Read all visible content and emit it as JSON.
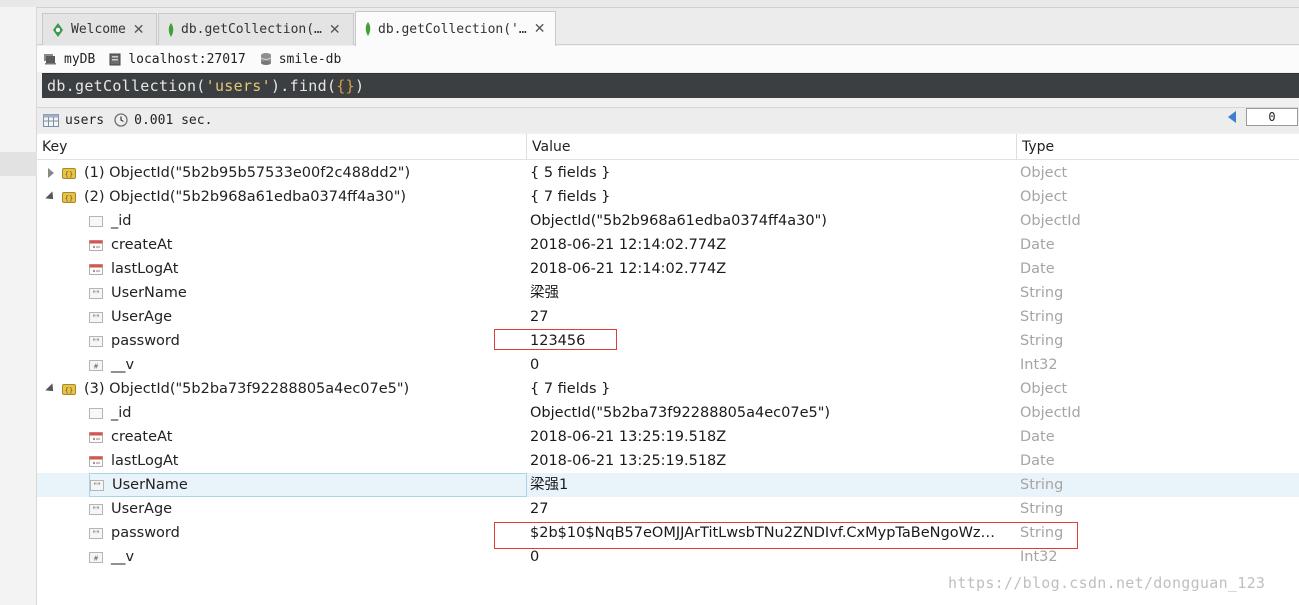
{
  "tabs": [
    {
      "label": "Welcome",
      "active": false
    },
    {
      "label": "db.getCollection(…",
      "active": false
    },
    {
      "label": "db.getCollection('…",
      "active": true
    }
  ],
  "path": {
    "database_label": "myDB",
    "host": "localhost:27017",
    "db_name": "smile-db"
  },
  "query": {
    "prefix": "db.getCollection(",
    "collection": "'users'",
    "middle": ").find(",
    "arg": "{}",
    "suffix": ")"
  },
  "result": {
    "collection": "users",
    "time": "0.001 sec.",
    "page_value": "0"
  },
  "columns": {
    "key": "Key",
    "value": "Value",
    "type": "Type"
  },
  "rows": [
    {
      "key": "(1) ObjectId(\"5b2b95b57533e00f2c488dd2\")",
      "value": "{ 5 fields }",
      "type": "Object",
      "icon": "object-icon"
    },
    {
      "key": "(2) ObjectId(\"5b2b968a61edba0374ff4a30\")",
      "value": "{ 7 fields }",
      "type": "Object",
      "icon": "object-icon"
    },
    {
      "key": "_id",
      "value": "ObjectId(\"5b2b968a61edba0374ff4a30\")",
      "type": "ObjectId",
      "icon": "objectid-icon"
    },
    {
      "key": "createAt",
      "value": "2018-06-21 12:14:02.774Z",
      "type": "Date",
      "icon": "date-icon"
    },
    {
      "key": "lastLogAt",
      "value": "2018-06-21 12:14:02.774Z",
      "type": "Date",
      "icon": "date-icon"
    },
    {
      "key": "UserName",
      "value": "梁强",
      "type": "String",
      "icon": "string-icon"
    },
    {
      "key": "UserAge",
      "value": "27",
      "type": "String",
      "icon": "string-icon"
    },
    {
      "key": "password",
      "value": "123456",
      "type": "String",
      "icon": "string-icon"
    },
    {
      "key": "__v",
      "value": "0",
      "type": "Int32",
      "icon": "int32-icon"
    },
    {
      "key": "(3) ObjectId(\"5b2ba73f92288805a4ec07e5\")",
      "value": "{ 7 fields }",
      "type": "Object",
      "icon": "object-icon"
    },
    {
      "key": "_id",
      "value": "ObjectId(\"5b2ba73f92288805a4ec07e5\")",
      "type": "ObjectId",
      "icon": "objectid-icon"
    },
    {
      "key": "createAt",
      "value": "2018-06-21 13:25:19.518Z",
      "type": "Date",
      "icon": "date-icon"
    },
    {
      "key": "lastLogAt",
      "value": "2018-06-21 13:25:19.518Z",
      "type": "Date",
      "icon": "date-icon"
    },
    {
      "key": "UserName",
      "value": "梁强1",
      "type": "String",
      "icon": "string-icon"
    },
    {
      "key": "UserAge",
      "value": "27",
      "type": "String",
      "icon": "string-icon"
    },
    {
      "key": "password",
      "value": "$2b$10$NqB57eOMJJArTitLwsbTNu2ZNDIvf.CxMypTaBeNgoWz…",
      "type": "String",
      "icon": "string-icon"
    },
    {
      "key": "__v",
      "value": "0",
      "type": "Int32",
      "icon": "int32-icon"
    }
  ],
  "watermark": "https://blog.csdn.net/dongguan_123"
}
